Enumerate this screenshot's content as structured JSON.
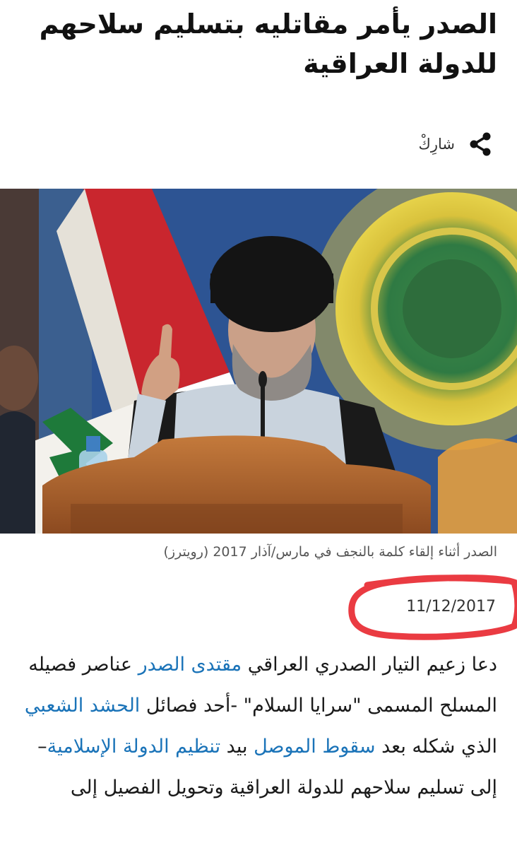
{
  "article": {
    "headline": "الصدر يأمر مقاتليه بتسليم سلاحهم للدولة العراقية",
    "share_label": "شارِكْ",
    "photo_caption": "الصدر أثناء إلقاء كلمة بالنجف في مارس/آذار 2017 (رويترز)",
    "date": "11/12/2017",
    "body": {
      "s1": "دعا زعيم التيار الصدري العراقي ",
      "link1": "مقتدى الصدر",
      "s2": " عناصر فصيله المسلح المسمى \"سرايا السلام\" -أحد فصائل ",
      "link2": "الحشد الشعبي",
      "s3": " الذي شكله بعد ",
      "link3": "سقوط الموصل",
      "s4": " بيد ",
      "link4": "تنظيم الدولة الإسلامية",
      "s5": "– إلى تسليم سلاحهم للدولة العراقية وتحويل الفصيل إلى"
    }
  },
  "colors": {
    "link": "#1a73b8",
    "highlight_circle": "#e8262e"
  },
  "icons": {
    "share": "share-icon"
  }
}
